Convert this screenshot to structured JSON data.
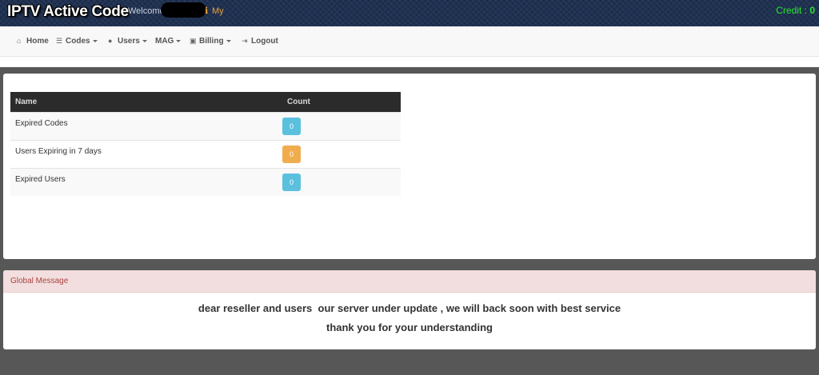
{
  "header": {
    "brand": "IPTV Active Code",
    "welcome_label": "Welcome",
    "my_link": "My",
    "credit_label": "Credit :",
    "credit_value": "0"
  },
  "nav": [
    {
      "label": "Home",
      "icon": "home-icon"
    },
    {
      "label": "Codes",
      "icon": "list-icon"
    },
    {
      "label": "Users",
      "icon": "user-icon"
    },
    {
      "label": "MAG",
      "icon": ""
    },
    {
      "label": "Billing",
      "icon": "money-icon"
    },
    {
      "label": "Logout",
      "icon": "logout-icon"
    }
  ],
  "stats": {
    "columns": [
      "Name",
      "Count"
    ],
    "rows": [
      {
        "name": "Expired Codes",
        "count": "0",
        "color": "#5bc0de"
      },
      {
        "name": "Users Expiring in 7 days",
        "count": "0",
        "color": "#f0ad4e"
      },
      {
        "name": "Expired Users",
        "count": "0",
        "color": "#5bc0de"
      }
    ]
  },
  "global_message": {
    "heading": "Global Message",
    "line1": "dear reseller and users  our server under update , we will back soon with best service",
    "line2": "thank you for your understanding"
  }
}
